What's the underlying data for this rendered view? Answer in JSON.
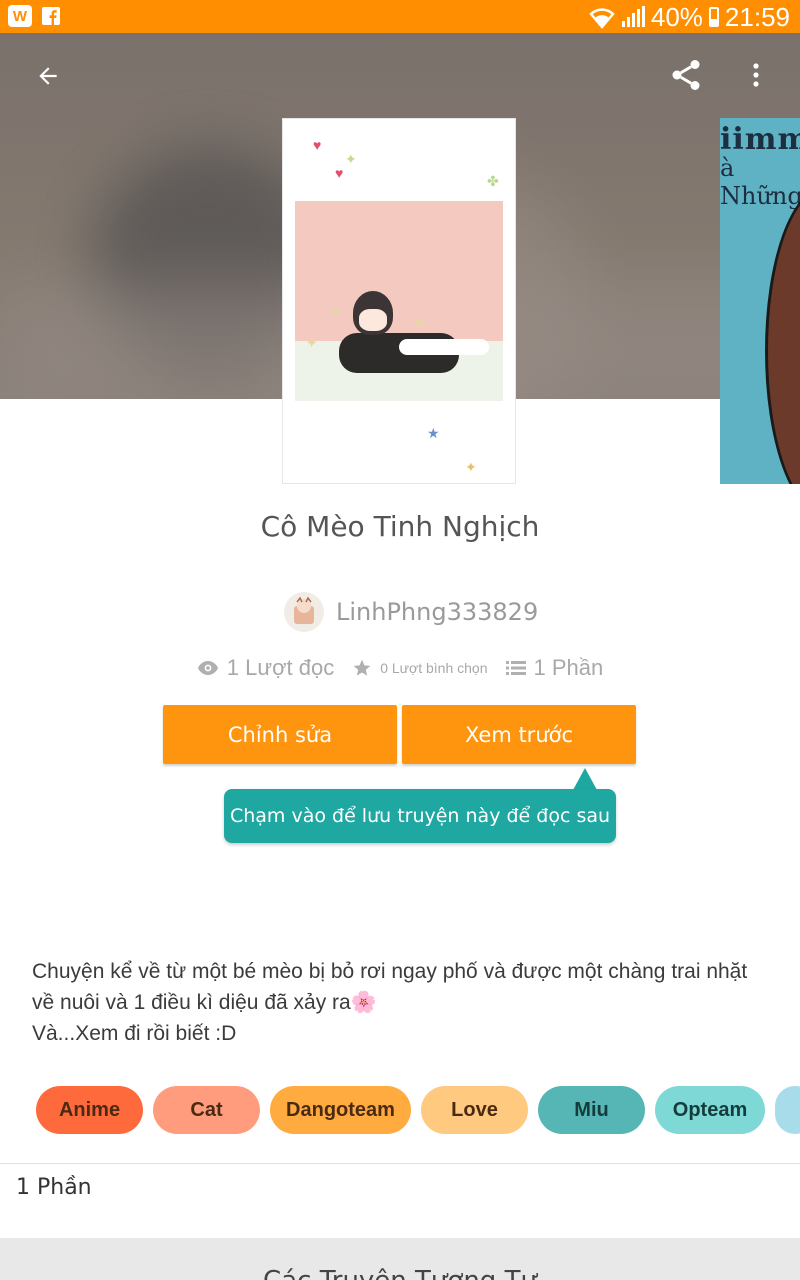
{
  "status_bar": {
    "app_badge": "W",
    "battery_percent": "40%",
    "battery_level": 0.4,
    "time": "21:59"
  },
  "header": {
    "back_icon": "arrow-left-icon",
    "share_icon": "share-icon",
    "more_icon": "more-vertical-icon"
  },
  "story": {
    "title": "Cô Mèo Tinh Nghịch",
    "author": "LinhPhng333829",
    "stats": {
      "reads": "1 Lượt đọc",
      "votes": "0 Lượt bình chọn",
      "parts": "1 Phần"
    },
    "description": [
      "Chuyện kể về từ một bé mèo bị bỏ rơi ngay phố và được một chàng trai nhặt về nuôi và 1 điều kì diệu đã xảy ra",
      "Và...Xem đi rồi biết :D"
    ]
  },
  "side_cover": {
    "line1": "iimmu",
    "line2": "à Những"
  },
  "actions": {
    "edit_label": "Chỉnh sửa",
    "preview_label": "Xem trước"
  },
  "tooltip": {
    "text": "Chạm vào để lưu truyện này để đọc sau"
  },
  "tags": [
    "Anime",
    "Cat",
    "Dangoteam",
    "Love",
    "Miu",
    "Opteam",
    ""
  ],
  "parts_section": {
    "label": "1 Phần"
  },
  "footer": {
    "text": "Các Truyện Tương Tự"
  },
  "colors": {
    "accent": "#ff950f",
    "status_bar": "#ff8f00",
    "tooltip": "#1fa7a1"
  }
}
